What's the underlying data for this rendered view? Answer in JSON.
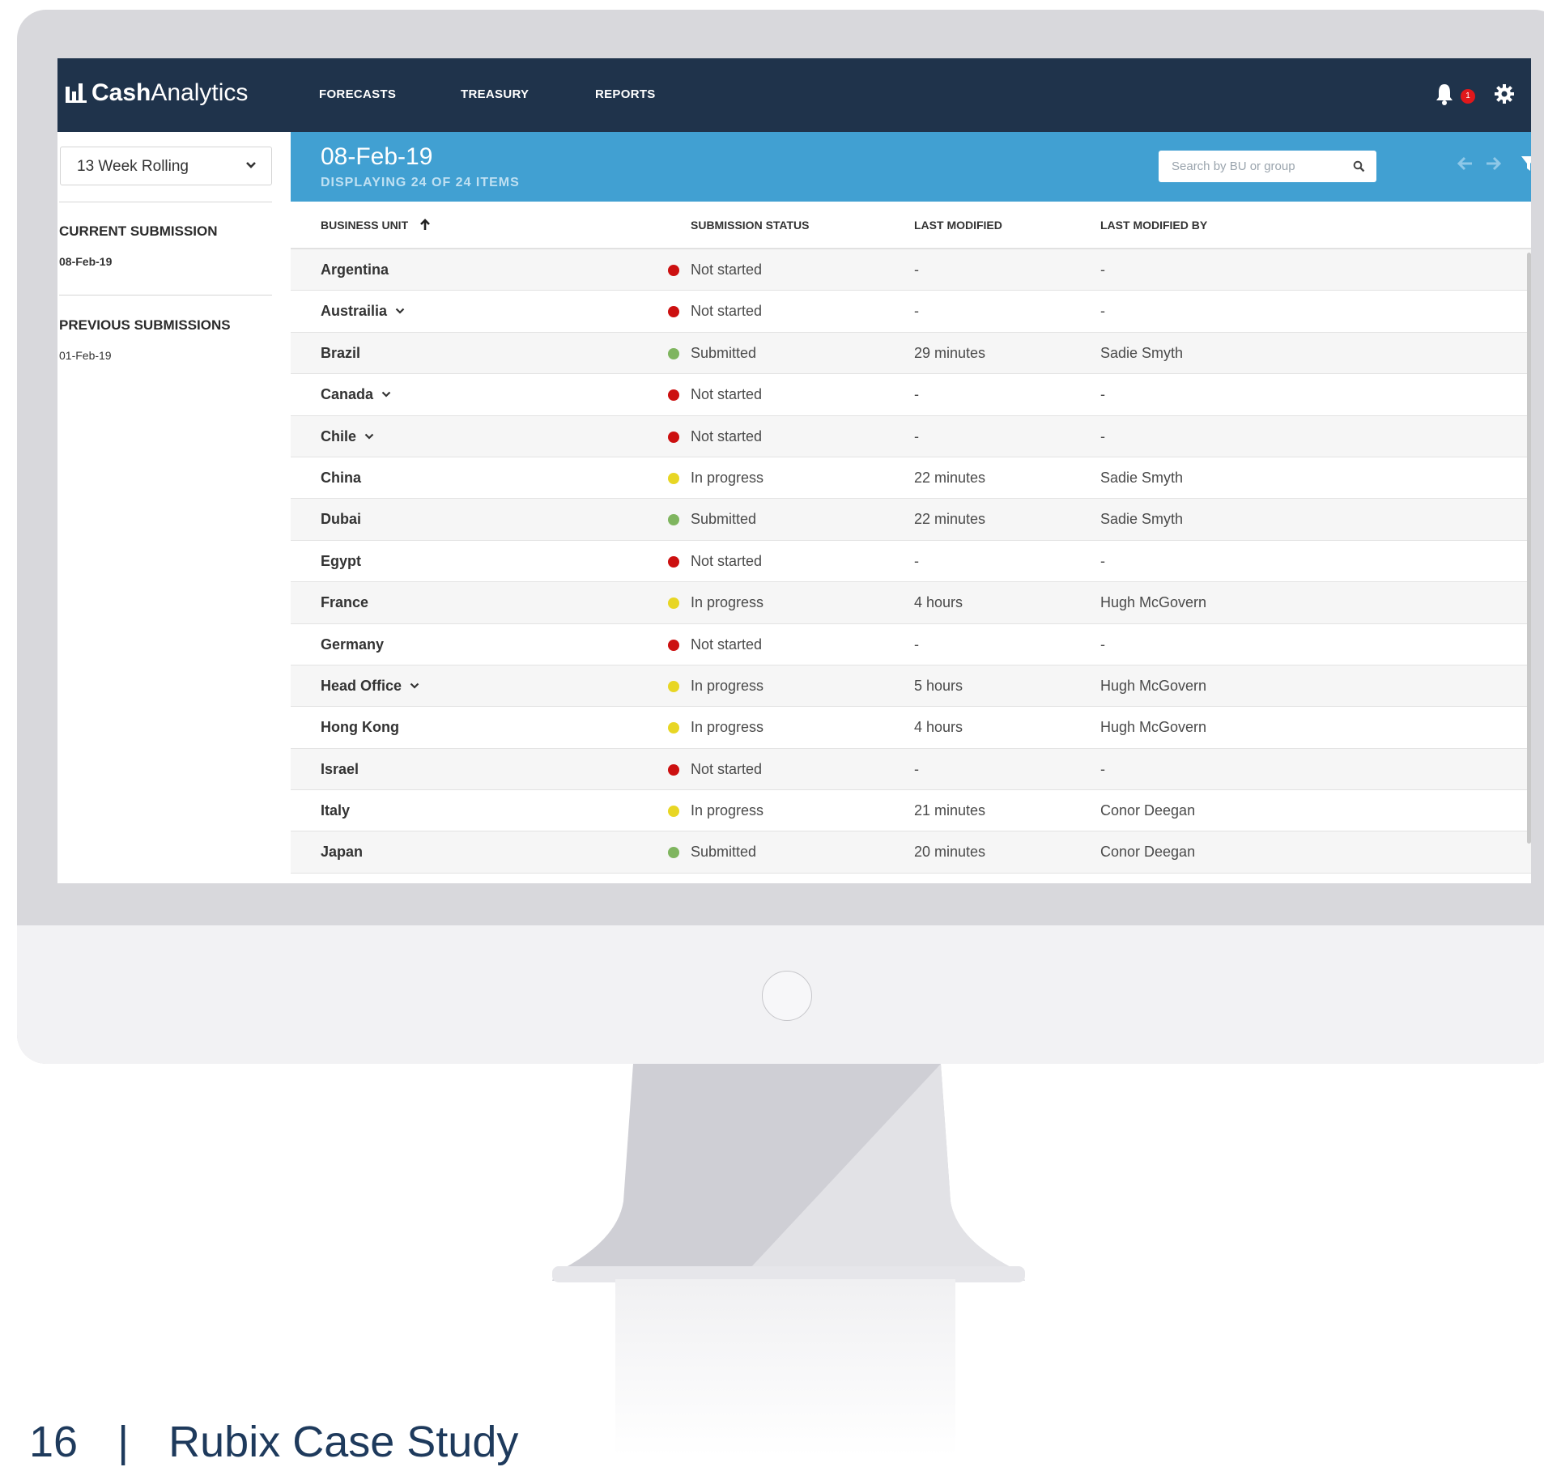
{
  "app": {
    "logo_bold": "Cash",
    "logo_light": "Analytics",
    "nav": [
      "FORECASTS",
      "TREASURY",
      "REPORTS"
    ],
    "notification_count": "1",
    "icons": [
      "bar-chart-icon",
      "bell-icon",
      "gear-icon",
      "search-icon",
      "arrow-left-icon",
      "arrow-right-icon",
      "filter-icon",
      "more-vertical-icon",
      "chevron-down-icon",
      "arrow-up-icon"
    ]
  },
  "sidebar": {
    "period": "13 Week Rolling",
    "current_heading": "CURRENT SUBMISSION",
    "current_date": "08-Feb-19",
    "previous_heading": "PREVIOUS SUBMISSIONS",
    "previous_date": "01-Feb-19"
  },
  "header": {
    "title": "08-Feb-19",
    "subtitle": "DISPLAYING 24 OF 24 ITEMS",
    "search_placeholder": "Search by BU or group"
  },
  "table": {
    "columns": [
      "BUSINESS UNIT",
      "SUBMISSION STATUS",
      "LAST MODIFIED",
      "LAST MODIFIED BY"
    ],
    "rows": [
      {
        "bu": "Argentina",
        "expandable": false,
        "status": "Not started",
        "status_color": "#cc1010",
        "modified": "-",
        "by": "-"
      },
      {
        "bu": "Austrailia",
        "expandable": true,
        "status": "Not started",
        "status_color": "#cc1010",
        "modified": "-",
        "by": "-"
      },
      {
        "bu": "Brazil",
        "expandable": false,
        "status": "Submitted",
        "status_color": "#7fb55f",
        "modified": "29 minutes",
        "by": "Sadie Smyth"
      },
      {
        "bu": "Canada",
        "expandable": true,
        "status": "Not started",
        "status_color": "#cc1010",
        "modified": "-",
        "by": "-"
      },
      {
        "bu": "Chile",
        "expandable": true,
        "status": "Not started",
        "status_color": "#cc1010",
        "modified": "-",
        "by": "-"
      },
      {
        "bu": "China",
        "expandable": false,
        "status": "In progress",
        "status_color": "#e8d624",
        "modified": "22 minutes",
        "by": "Sadie Smyth"
      },
      {
        "bu": "Dubai",
        "expandable": false,
        "status": "Submitted",
        "status_color": "#7fb55f",
        "modified": "22 minutes",
        "by": "Sadie Smyth"
      },
      {
        "bu": "Egypt",
        "expandable": false,
        "status": "Not started",
        "status_color": "#cc1010",
        "modified": "-",
        "by": "-"
      },
      {
        "bu": "France",
        "expandable": false,
        "status": "In progress",
        "status_color": "#e8d624",
        "modified": "4 hours",
        "by": "Hugh McGovern"
      },
      {
        "bu": "Germany",
        "expandable": false,
        "status": "Not started",
        "status_color": "#cc1010",
        "modified": "-",
        "by": "-"
      },
      {
        "bu": "Head Office",
        "expandable": true,
        "status": "In progress",
        "status_color": "#e8d624",
        "modified": "5 hours",
        "by": "Hugh McGovern"
      },
      {
        "bu": "Hong Kong",
        "expandable": false,
        "status": "In progress",
        "status_color": "#e8d624",
        "modified": "4 hours",
        "by": "Hugh McGovern"
      },
      {
        "bu": "Israel",
        "expandable": false,
        "status": "Not started",
        "status_color": "#cc1010",
        "modified": "-",
        "by": "-"
      },
      {
        "bu": "Italy",
        "expandable": false,
        "status": "In progress",
        "status_color": "#e8d624",
        "modified": "21 minutes",
        "by": "Conor Deegan"
      },
      {
        "bu": "Japan",
        "expandable": false,
        "status": "Submitted",
        "status_color": "#7fb55f",
        "modified": "20 minutes",
        "by": "Conor Deegan"
      }
    ]
  },
  "caption": {
    "page_number": "16",
    "separator": "|",
    "title": "Rubix Case Study"
  }
}
